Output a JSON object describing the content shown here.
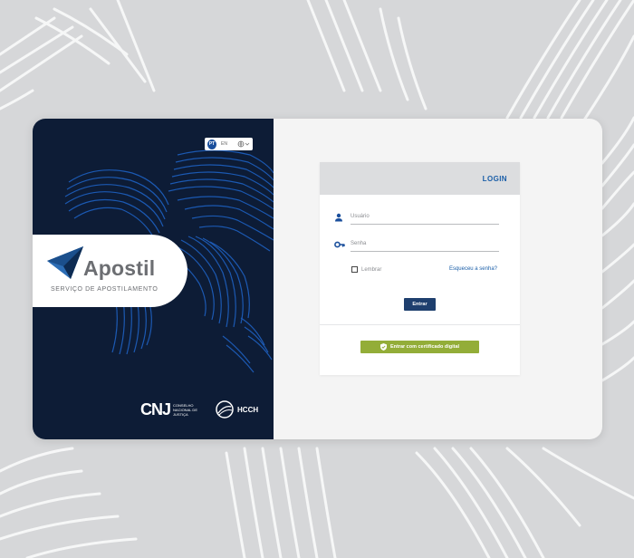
{
  "language": {
    "active": "PT",
    "other": "EN",
    "globe_icon": "globe-icon"
  },
  "brand": {
    "name": "Apostil",
    "subtitle": "SERVIÇO DE APOSTILAMENTO"
  },
  "partners": {
    "cnj_mark": "CNJ",
    "cnj_text": "CONSELHO NACIONAL DE JUSTIÇA",
    "hcch_text": "HCCH"
  },
  "login": {
    "title": "LOGIN",
    "username_placeholder": "Usuário",
    "password_placeholder": "Senha",
    "remember_label": "Lembrar",
    "forgot_link": "Esqueceu a senha?",
    "submit_label": "Entrar",
    "certificate_label": "Entrar com certificado digital"
  },
  "colors": {
    "panel_dark": "#0d1c36",
    "map_blue": "#1f64c8",
    "accent_blue": "#1a5ea8",
    "button_navy": "#1e3f6e",
    "certificate_green": "#93ad38"
  }
}
